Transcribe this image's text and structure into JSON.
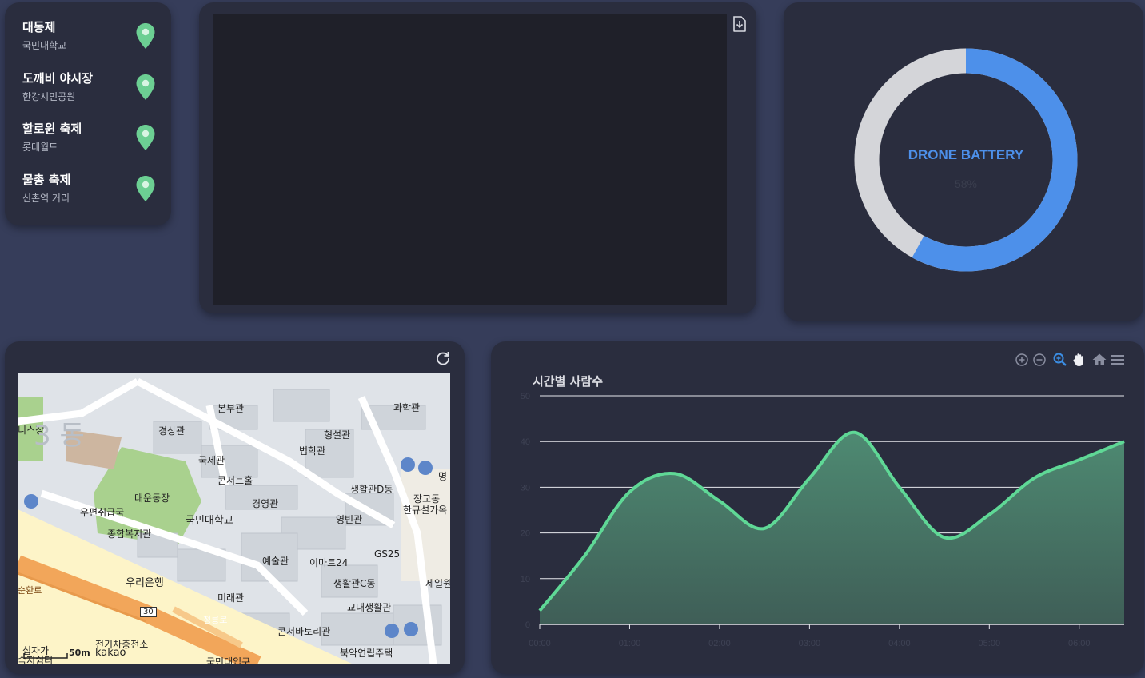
{
  "festivals": [
    {
      "name": "대동제",
      "place": "국민대학교"
    },
    {
      "name": "도깨비 야시장",
      "place": "한강시민공원"
    },
    {
      "name": "할로윈 축제",
      "place": "롯데월드"
    },
    {
      "name": "물총 축제",
      "place": "신촌역 거리"
    }
  ],
  "battery": {
    "title": "DRONE BATTERY",
    "percent_label": "58%",
    "percent": 58,
    "fill_color": "#4d90ea",
    "track_color": "#d4d5d9"
  },
  "map": {
    "labels": {
      "l1": "본부관",
      "l2": "과학관",
      "l3": "형설관",
      "l4": "경상관",
      "l5": "법학관",
      "l6": "국제관",
      "l7": "콘서트홀",
      "l8": "생활관D동",
      "l9": "대운동장",
      "l10": "경영관",
      "l11": "우편취급국",
      "l12": "국민대학교",
      "l13": "영빈관",
      "l14": "장교동",
      "l15": "한규설가옥",
      "l16": "종합복지관",
      "l17": "GS25",
      "l18": "예술관",
      "l19": "이마트24",
      "l20": "우리은행",
      "l21": "생활관C동",
      "l22": "제일원",
      "l23": "미래관",
      "l24": "교내생활관",
      "l25": "순환로",
      "l26": "정릉로",
      "l27": "콘서바토리관",
      "l28": "전기차충전소",
      "l29": "북악연립주택",
      "l30": "국민대입구",
      "l31": "십자가",
      "l32": "숙지쉼터",
      "l33": "니스장",
      "l34": "명",
      "l35": "3 동",
      "l36": "30"
    },
    "scale": "50m",
    "brand": "kakao"
  },
  "chart_data": {
    "type": "area",
    "title": "시간별 사람수",
    "x": [
      "00:00",
      "00:30",
      "01:00",
      "01:30",
      "02:00",
      "02:30",
      "03:00",
      "03:30",
      "04:00",
      "04:30",
      "05:00",
      "05:30",
      "06:00",
      "06:30"
    ],
    "x_ticks": [
      "00:00",
      "01:00",
      "02:00",
      "03:00",
      "04:00",
      "05:00",
      "06:00"
    ],
    "y_ticks": [
      "0",
      "10",
      "20",
      "30",
      "40",
      "50"
    ],
    "values": [
      3,
      15,
      29,
      33,
      27,
      21,
      32,
      42,
      30,
      19,
      24,
      32,
      36,
      40
    ],
    "ylim": [
      0,
      50
    ],
    "line_color": "#5fd896",
    "fill_color": "#4a7a67"
  }
}
